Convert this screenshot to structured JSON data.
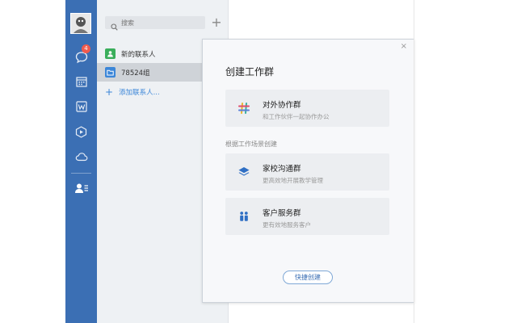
{
  "rail": {
    "badge_count": "4",
    "colors": {
      "background": "#3b6fb4",
      "badge": "#f05a4d"
    },
    "icons": [
      "avatar",
      "chat-icon",
      "calendar-icon",
      "doc-icon",
      "cube-icon",
      "cloud-icon",
      "contacts-icon"
    ]
  },
  "contacts": {
    "search_placeholder": "搜索",
    "add_button": "+",
    "items": [
      {
        "label": "新的联系人",
        "icon": "new-contact-icon",
        "color": "#3aae5b"
      },
      {
        "label": "78524组",
        "icon": "folder-icon",
        "color": "#3b86d8"
      }
    ],
    "add_contact_label": "添加联系人...",
    "add_contact_plus": "+"
  },
  "dialog": {
    "close": "×",
    "title": "创建工作群",
    "options": [
      {
        "title": "对外协作群",
        "subtitle": "和工作伙伴一起协作办公",
        "icon": "hash-icon"
      },
      {
        "title": "家校沟通群",
        "subtitle": "更高效地开展教学管理",
        "icon": "layers-icon"
      },
      {
        "title": "客户服务群",
        "subtitle": "更有效地服务客户",
        "icon": "people-icon"
      }
    ],
    "section_label": "根据工作场景创建",
    "quick_create": "快捷创建",
    "accent": "#3b6fb4"
  }
}
